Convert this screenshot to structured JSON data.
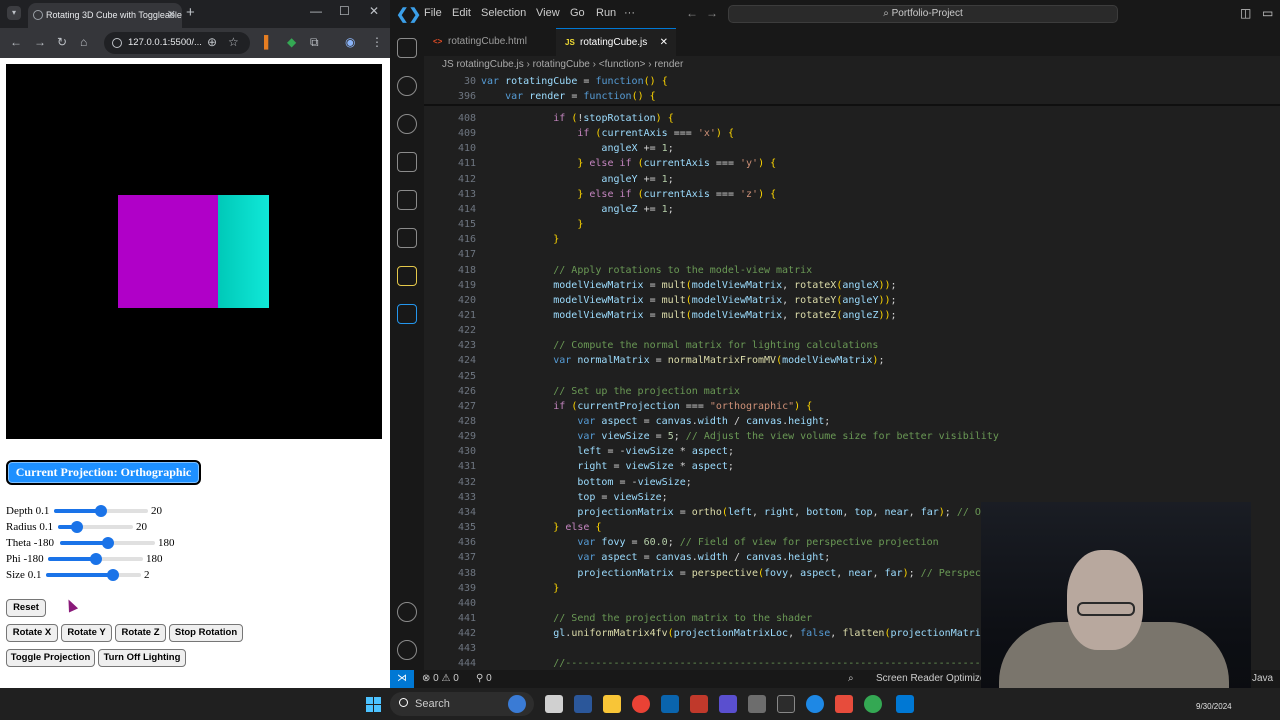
{
  "browser": {
    "tab_title": "Rotating 3D Cube with Toggleable...",
    "url": "127.0.0.1:5500/...",
    "projection_button": "Current Projection: Orthographic",
    "sliders": [
      {
        "label": "Depth",
        "min": "0.1",
        "max": "20",
        "fraction": 0.5
      },
      {
        "label": "Radius",
        "min": "0.1",
        "max": "20",
        "fraction": 0.25
      },
      {
        "label": "Theta",
        "min": "-180",
        "max": "180",
        "fraction": 0.5
      },
      {
        "label": "Phi",
        "min": "-180",
        "max": "180",
        "fraction": 0.5
      },
      {
        "label": "Size",
        "min": "0.1",
        "max": "2",
        "fraction": 0.7
      }
    ],
    "buttons": {
      "reset": "Reset",
      "rotate_x": "Rotate X",
      "rotate_y": "Rotate Y",
      "rotate_z": "Rotate Z",
      "stop_rotation": "Stop Rotation",
      "toggle_projection": "Toggle Projection",
      "turn_off_lighting": "Turn Off Lighting"
    },
    "colors": {
      "cube_front": "#b000c8",
      "cube_side": "#10e8d8",
      "projection_button": "#1e90ff"
    }
  },
  "vscode": {
    "menu": [
      "File",
      "Edit",
      "Selection",
      "View",
      "Go",
      "Run",
      "···"
    ],
    "command_center": "Portfolio-Project",
    "tabs": [
      {
        "label": "rotatingCube.html",
        "icon": "html-icon",
        "active": false
      },
      {
        "label": "rotatingCube.js",
        "icon": "js-icon",
        "active": true
      }
    ],
    "breadcrumb": [
      "JS rotatingCube.js",
      "rotatingCube",
      "<function>",
      "render"
    ],
    "sticky_lines": [
      {
        "num": "30",
        "text": "var rotatingCube = function() {"
      },
      {
        "num": "396",
        "text": "    var render = function() {"
      }
    ],
    "code_lines": [
      {
        "num": "408",
        "text": "            if (!stopRotation) {"
      },
      {
        "num": "409",
        "text": "                if (currentAxis === 'x') {"
      },
      {
        "num": "410",
        "text": "                    angleX += 1;"
      },
      {
        "num": "411",
        "text": "                } else if (currentAxis === 'y') {"
      },
      {
        "num": "412",
        "text": "                    angleY += 1;"
      },
      {
        "num": "413",
        "text": "                } else if (currentAxis === 'z') {"
      },
      {
        "num": "414",
        "text": "                    angleZ += 1;"
      },
      {
        "num": "415",
        "text": "                }"
      },
      {
        "num": "416",
        "text": "            }"
      },
      {
        "num": "417",
        "text": ""
      },
      {
        "num": "418",
        "text": "            // Apply rotations to the model-view matrix"
      },
      {
        "num": "419",
        "text": "            modelViewMatrix = mult(modelViewMatrix, rotateX(angleX));"
      },
      {
        "num": "420",
        "text": "            modelViewMatrix = mult(modelViewMatrix, rotateY(angleY));"
      },
      {
        "num": "421",
        "text": "            modelViewMatrix = mult(modelViewMatrix, rotateZ(angleZ));"
      },
      {
        "num": "422",
        "text": ""
      },
      {
        "num": "423",
        "text": "            // Compute the normal matrix for lighting calculations"
      },
      {
        "num": "424",
        "text": "            var normalMatrix = normalMatrixFromMV(modelViewMatrix);"
      },
      {
        "num": "425",
        "text": ""
      },
      {
        "num": "426",
        "text": "            // Set up the projection matrix"
      },
      {
        "num": "427",
        "text": "            if (currentProjection === \"orthographic\") {"
      },
      {
        "num": "428",
        "text": "                var aspect = canvas.width / canvas.height;"
      },
      {
        "num": "429",
        "text": "                var viewSize = 5; // Adjust the view volume size for better visibility"
      },
      {
        "num": "430",
        "text": "                left = -viewSize * aspect;"
      },
      {
        "num": "431",
        "text": "                right = viewSize * aspect;"
      },
      {
        "num": "432",
        "text": "                bottom = -viewSize;"
      },
      {
        "num": "433",
        "text": "                top = viewSize;"
      },
      {
        "num": "434",
        "text": "                projectionMatrix = ortho(left, right, bottom, top, near, far); // Ort"
      },
      {
        "num": "435",
        "text": "            } else {"
      },
      {
        "num": "436",
        "text": "                var fovy = 60.0; // Field of view for perspective projection"
      },
      {
        "num": "437",
        "text": "                var aspect = canvas.width / canvas.height;"
      },
      {
        "num": "438",
        "text": "                projectionMatrix = perspective(fovy, aspect, near, far); // Perspecti"
      },
      {
        "num": "439",
        "text": "            }"
      },
      {
        "num": "440",
        "text": ""
      },
      {
        "num": "441",
        "text": "            // Send the projection matrix to the shader"
      },
      {
        "num": "442",
        "text": "            gl.uniformMatrix4fv(projectionMatrixLoc, false, flatten(projectionMatrix)"
      },
      {
        "num": "443",
        "text": ""
      },
      {
        "num": "444",
        "text": "            //------------------------------------------------------------------------"
      }
    ],
    "status": {
      "errors": "0",
      "warnings": "0",
      "ports": "0",
      "screen_reader": "Screen Reader Optimized",
      "language": "Java"
    },
    "colors": {
      "keyword": "#569cd6",
      "function": "#dcdcaa",
      "string": "#ce9178",
      "comment": "#6a9955",
      "number": "#b5cea8",
      "variable": "#9cdcfe"
    }
  },
  "taskbar": {
    "search": "Search",
    "date": "9/30/2024"
  }
}
